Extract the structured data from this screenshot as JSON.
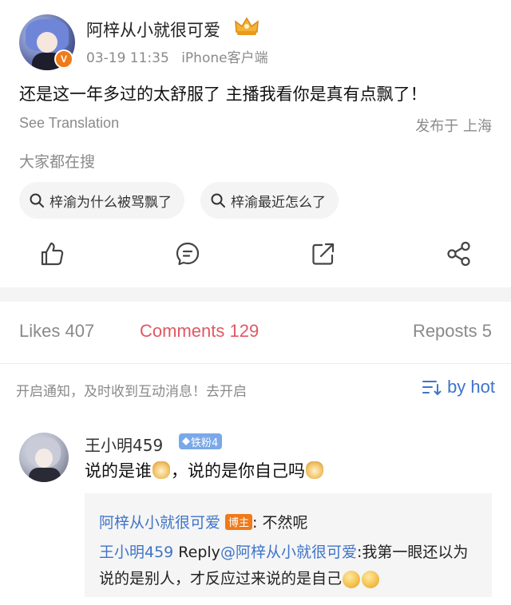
{
  "post": {
    "author": "阿梓从小就很可爱",
    "time": "03-19 11:35",
    "client": "iPhone客户端",
    "verified_badge": "V",
    "text": "还是这一年多过的太舒服了 主播我看你是真有点飘了！",
    "see_translation": "See Translation",
    "location": "发布于 上海"
  },
  "search": {
    "label": "大家都在搜",
    "chips": [
      "梓渝为什么被骂飘了",
      "梓渝最近怎么了"
    ]
  },
  "actions": {
    "like_icon": "thumbs-up-icon",
    "comment_icon": "comment-icon",
    "repost_icon": "share-out-icon",
    "share_icon": "share-network-icon"
  },
  "tabs": {
    "likes": "Likes 407",
    "comments": "Comments 129",
    "reposts": "Reposts 5"
  },
  "notify": {
    "text": "开启通知，及时收到互动消息！去开启",
    "sort_label": "by hot"
  },
  "comment": {
    "author": "王小明459",
    "fan_badge": "铁粉4",
    "text_part1": "说的是谁",
    "text_part2": "，说的是你自己吗",
    "replies": [
      {
        "author": "阿梓从小就很可爱",
        "badge": "博主",
        "text": ": 不然呢"
      },
      {
        "author": "王小明459",
        "reply_word": " Reply",
        "mention": "@阿梓从小就很可爱",
        "text": ":我第一眼还以为说的是别人，才反应过来说的是自己"
      }
    ]
  },
  "colors": {
    "accent_red": "#e05863",
    "link_blue": "#3f74c9",
    "badge_orange": "#f07a18",
    "fan_badge_blue": "#7aa8e8"
  }
}
